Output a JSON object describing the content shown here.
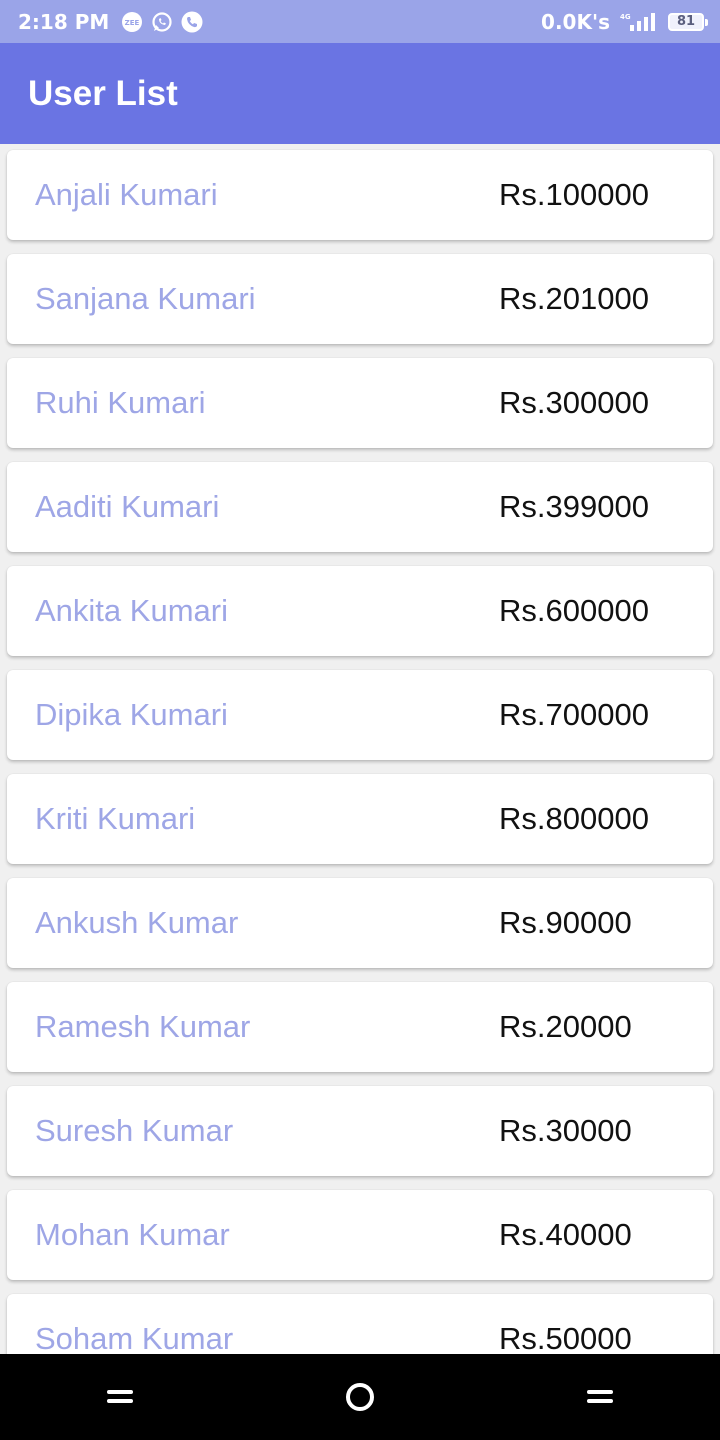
{
  "status_bar": {
    "time": "2:18 PM",
    "net_speed": "0.0K's",
    "network_type": "4G",
    "battery": "81",
    "notification_icons": [
      "zee5-icon",
      "whatsapp-icon",
      "phone-icon"
    ]
  },
  "app_bar": {
    "title": "User List",
    "color": "#6a74e3"
  },
  "users": [
    {
      "name": "Anjali Kumari",
      "amount": "Rs.100000"
    },
    {
      "name": "Sanjana Kumari",
      "amount": "Rs.201000"
    },
    {
      "name": "Ruhi Kumari",
      "amount": "Rs.300000"
    },
    {
      "name": "Aaditi Kumari",
      "amount": "Rs.399000"
    },
    {
      "name": "Ankita Kumari",
      "amount": "Rs.600000"
    },
    {
      "name": "Dipika Kumari",
      "amount": "Rs.700000"
    },
    {
      "name": "Kriti Kumari",
      "amount": "Rs.800000"
    },
    {
      "name": "Ankush Kumar",
      "amount": "Rs.90000"
    },
    {
      "name": "Ramesh Kumar",
      "amount": "Rs.20000"
    },
    {
      "name": "Suresh Kumar",
      "amount": "Rs.30000"
    },
    {
      "name": "Mohan Kumar",
      "amount": "Rs.40000"
    },
    {
      "name": "Soham Kumar",
      "amount": "Rs.50000"
    }
  ],
  "nav_bar": {
    "buttons": [
      "menu-icon",
      "home-icon",
      "back-icon"
    ]
  }
}
